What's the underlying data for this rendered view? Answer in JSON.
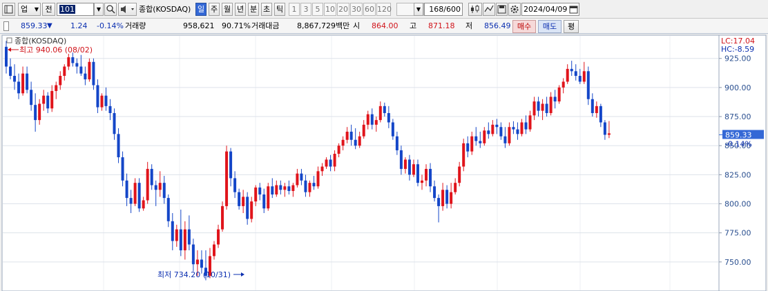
{
  "toolbar": {
    "market_label": "업",
    "prev_label": "전",
    "code_value": "101",
    "index_name": "종합(KOSDAQ)",
    "periods": [
      {
        "label": "일",
        "active": true
      },
      {
        "label": "주",
        "active": false
      },
      {
        "label": "월",
        "active": false
      },
      {
        "label": "년",
        "active": false
      },
      {
        "label": "분",
        "active": false
      },
      {
        "label": "초",
        "active": false
      },
      {
        "label": "틱",
        "active": false
      }
    ],
    "intervals": [
      "1",
      "3",
      "5",
      "10",
      "20",
      "30",
      "60",
      "120"
    ],
    "count_value": "168",
    "count_max": "/600",
    "date_value": "2024/04/09"
  },
  "quote": {
    "price": "859.33",
    "change_arrow": "▼",
    "change": "1.24",
    "change_pct": "-0.14%",
    "volume_label": "거래량",
    "volume": "958,621",
    "volume_ratio": "90.71%",
    "amount_label": "거래대금",
    "amount": "8,867,729백만",
    "open_label": "시",
    "open": "864.00",
    "high_label": "고",
    "high": "871.18",
    "low_label": "저",
    "low": "856.49",
    "buy_label": "매수",
    "sell_label": "매도",
    "eval_label": "평"
  },
  "colors": {
    "up": "#e0141b",
    "down": "#1446c8",
    "accent": "#3468d6"
  },
  "chart_data": {
    "type": "candlestick",
    "title": "종합(KOSDAQ)",
    "ylim": [
      725,
      945
    ],
    "yticks": [
      "925.00",
      "900.00",
      "875.00",
      "850.00",
      "825.00",
      "800.00",
      "775.00",
      "750.00"
    ],
    "ytick_values": [
      925,
      900,
      875,
      850,
      825,
      800,
      775,
      750
    ],
    "lc_label": "LC:17.04",
    "hc_label": "HC:-8.59",
    "last_price_label": "859.33",
    "last_change_label": "-0.14%",
    "last_price": 859.33,
    "high_annotation": "최고 940.06 (08/02)",
    "low_annotation": "최저 734.20 (10/31)",
    "candles": [
      [
        935.0,
        940.06,
        912.0,
        918.0
      ],
      [
        918.0,
        925.0,
        907.0,
        910.0
      ],
      [
        910.0,
        920.0,
        898.0,
        905.0
      ],
      [
        905.0,
        912.0,
        890.0,
        895.0
      ],
      [
        895.0,
        918.0,
        893.0,
        912.0
      ],
      [
        912.0,
        918.0,
        895.0,
        898.0
      ],
      [
        898.0,
        905.0,
        880.0,
        885.0
      ],
      [
        885.0,
        895.0,
        862.0,
        872.0
      ],
      [
        872.0,
        890.0,
        868.0,
        886.0
      ],
      [
        886.0,
        898.0,
        880.0,
        893.0
      ],
      [
        893.0,
        896.0,
        878.0,
        882.0
      ],
      [
        882.0,
        902.0,
        879.0,
        897.0
      ],
      [
        897.0,
        905.0,
        890.0,
        902.0
      ],
      [
        902.0,
        914.0,
        898.0,
        910.0
      ],
      [
        910.0,
        920.0,
        906.0,
        918.0
      ],
      [
        918.0,
        929.0,
        915.0,
        926.0
      ],
      [
        926.0,
        930.0,
        918.0,
        921.0
      ],
      [
        921.0,
        925.0,
        912.0,
        918.0
      ],
      [
        918.0,
        928.0,
        910.0,
        912.0
      ],
      [
        912.0,
        918.0,
        902.0,
        907.0
      ],
      [
        907.0,
        925.0,
        905.0,
        922.0
      ],
      [
        922.0,
        925.0,
        898.0,
        902.0
      ],
      [
        902.0,
        907.0,
        878.0,
        883.0
      ],
      [
        883.0,
        895.0,
        880.0,
        893.0
      ],
      [
        893.0,
        900.0,
        880.0,
        884.0
      ],
      [
        884.0,
        890.0,
        872.0,
        878.0
      ],
      [
        878.0,
        882.0,
        855.0,
        860.0
      ],
      [
        860.0,
        865.0,
        835.0,
        840.0
      ],
      [
        840.0,
        845.0,
        815.0,
        820.0
      ],
      [
        820.0,
        826.0,
        798.0,
        805.0
      ],
      [
        805.0,
        812.0,
        792.0,
        800.0
      ],
      [
        800.0,
        822.0,
        798.0,
        818.0
      ],
      [
        818.0,
        822.0,
        793.0,
        796.0
      ],
      [
        796.0,
        806.0,
        794.0,
        803.0
      ],
      [
        803.0,
        836.0,
        800.0,
        830.0
      ],
      [
        830.0,
        834.0,
        812.0,
        816.0
      ],
      [
        816.0,
        820.0,
        798.0,
        812.0
      ],
      [
        812.0,
        828.0,
        806.0,
        818.0
      ],
      [
        818.0,
        824.0,
        800.0,
        805.0
      ],
      [
        805.0,
        808.0,
        780.0,
        785.0
      ],
      [
        785.0,
        792.0,
        760.0,
        768.0
      ],
      [
        768.0,
        782.0,
        763.0,
        778.0
      ],
      [
        778.0,
        795.0,
        755.0,
        760.0
      ],
      [
        760.0,
        785.0,
        752.0,
        778.0
      ],
      [
        778.0,
        790.0,
        760.0,
        765.0
      ],
      [
        765.0,
        770.0,
        742.0,
        748.0
      ],
      [
        748.0,
        760.0,
        738.0,
        752.0
      ],
      [
        752.0,
        760.0,
        740.0,
        745.0
      ],
      [
        745.0,
        760.0,
        734.2,
        738.0
      ],
      [
        738.0,
        762.0,
        736.0,
        755.0
      ],
      [
        755.0,
        768.0,
        752.0,
        765.0
      ],
      [
        765.0,
        782.0,
        762.0,
        778.0
      ],
      [
        778.0,
        802.0,
        776.0,
        798.0
      ],
      [
        798.0,
        850.0,
        795.0,
        845.0
      ],
      [
        845.0,
        848.0,
        815.0,
        822.0
      ],
      [
        822.0,
        828.0,
        805.0,
        810.0
      ],
      [
        810.0,
        813.0,
        795.0,
        798.0
      ],
      [
        798.0,
        812.0,
        792.0,
        806.0
      ],
      [
        806.0,
        810.0,
        782.0,
        787.0
      ],
      [
        787.0,
        806.0,
        784.0,
        802.0
      ],
      [
        802.0,
        816.0,
        798.0,
        814.0
      ],
      [
        814.0,
        818.0,
        803.0,
        808.0
      ],
      [
        808.0,
        813.0,
        792.0,
        796.0
      ],
      [
        796.0,
        818.0,
        794.0,
        815.0
      ],
      [
        815.0,
        822.0,
        805.0,
        808.0
      ],
      [
        808.0,
        820.0,
        806.0,
        816.0
      ],
      [
        816.0,
        820.0,
        808.0,
        812.0
      ],
      [
        812.0,
        818.0,
        806.0,
        815.0
      ],
      [
        815.0,
        820.0,
        808.0,
        811.0
      ],
      [
        811.0,
        818.0,
        806.0,
        816.0
      ],
      [
        816.0,
        830.0,
        814.0,
        826.0
      ],
      [
        826.0,
        830.0,
        816.0,
        820.0
      ],
      [
        820.0,
        825.0,
        806.0,
        810.0
      ],
      [
        810.0,
        820.0,
        806.0,
        818.0
      ],
      [
        818.0,
        824.0,
        812.0,
        815.0
      ],
      [
        815.0,
        832.0,
        813.0,
        828.0
      ],
      [
        828.0,
        835.0,
        824.0,
        832.0
      ],
      [
        832.0,
        840.0,
        830.0,
        838.0
      ],
      [
        838.0,
        842.0,
        828.0,
        832.0
      ],
      [
        832.0,
        846.0,
        828.0,
        843.0
      ],
      [
        843.0,
        852.0,
        840.0,
        850.0
      ],
      [
        850.0,
        858.0,
        846.0,
        855.0
      ],
      [
        855.0,
        866.0,
        852.0,
        862.0
      ],
      [
        862.0,
        868.0,
        850.0,
        855.0
      ],
      [
        855.0,
        865.0,
        847.0,
        850.0
      ],
      [
        850.0,
        862.0,
        848.0,
        858.0
      ],
      [
        858.0,
        872.0,
        856.0,
        868.0
      ],
      [
        868.0,
        880.0,
        864.0,
        877.0
      ],
      [
        877.0,
        882.0,
        864.0,
        868.0
      ],
      [
        868.0,
        875.0,
        862.0,
        872.0
      ],
      [
        872.0,
        888.0,
        870.0,
        884.0
      ],
      [
        884.0,
        887.0,
        875.0,
        878.0
      ],
      [
        878.0,
        884.0,
        865.0,
        870.0
      ],
      [
        870.0,
        873.0,
        855.0,
        858.0
      ],
      [
        858.0,
        862.0,
        842.0,
        846.0
      ],
      [
        846.0,
        850.0,
        825.0,
        830.0
      ],
      [
        830.0,
        840.0,
        826.0,
        838.0
      ],
      [
        838.0,
        842.0,
        820.0,
        825.0
      ],
      [
        825.0,
        838.0,
        823.0,
        834.0
      ],
      [
        834.0,
        838.0,
        815.0,
        818.0
      ],
      [
        818.0,
        825.0,
        812.0,
        820.0
      ],
      [
        820.0,
        834.0,
        815.0,
        830.0
      ],
      [
        830.0,
        835.0,
        810.0,
        815.0
      ],
      [
        815.0,
        820.0,
        802.0,
        805.0
      ],
      [
        805.0,
        808.0,
        784.0,
        798.0
      ],
      [
        798.0,
        818.0,
        794.0,
        812.0
      ],
      [
        812.0,
        816.0,
        796.0,
        800.0
      ],
      [
        800.0,
        818.0,
        796.0,
        810.0
      ],
      [
        810.0,
        822.0,
        808.0,
        818.0
      ],
      [
        818.0,
        836.0,
        815.0,
        832.0
      ],
      [
        832.0,
        856.0,
        828.0,
        852.0
      ],
      [
        852.0,
        858.0,
        840.0,
        845.0
      ],
      [
        845.0,
        862.0,
        842.0,
        858.0
      ],
      [
        858.0,
        866.0,
        850.0,
        854.0
      ],
      [
        854.0,
        862.0,
        848.0,
        852.0
      ],
      [
        852.0,
        866.0,
        850.0,
        863.0
      ],
      [
        863.0,
        870.0,
        856.0,
        860.0
      ],
      [
        860.0,
        872.0,
        858.0,
        868.0
      ],
      [
        868.0,
        873.0,
        860.0,
        866.0
      ],
      [
        866.0,
        870.0,
        855.0,
        858.0
      ],
      [
        858.0,
        866.0,
        848.0,
        852.0
      ],
      [
        852.0,
        870.0,
        850.0,
        866.0
      ],
      [
        866.0,
        871.0,
        860.0,
        864.0
      ],
      [
        864.0,
        870.0,
        855.0,
        860.0
      ],
      [
        860.0,
        873.0,
        858.0,
        870.0
      ],
      [
        870.0,
        876.0,
        860.0,
        864.0
      ],
      [
        864.0,
        880.0,
        862.0,
        876.0
      ],
      [
        876.0,
        892.0,
        872.0,
        888.0
      ],
      [
        888.0,
        892.0,
        875.0,
        880.0
      ],
      [
        880.0,
        890.0,
        872.0,
        886.0
      ],
      [
        886.0,
        892.0,
        875.0,
        878.0
      ],
      [
        878.0,
        896.0,
        876.0,
        892.0
      ],
      [
        892.0,
        898.0,
        882.0,
        888.0
      ],
      [
        888.0,
        902.0,
        886.0,
        900.0
      ],
      [
        900.0,
        908.0,
        895.0,
        905.0
      ],
      [
        905.0,
        920.0,
        903.0,
        916.0
      ],
      [
        916.0,
        923.0,
        910.0,
        914.0
      ],
      [
        914.0,
        920.0,
        906.0,
        910.0
      ],
      [
        910.0,
        916.0,
        903.0,
        905.0
      ],
      [
        905.0,
        922.0,
        903.0,
        914.0
      ],
      [
        914.0,
        918.0,
        885.0,
        890.0
      ],
      [
        890.0,
        895.0,
        875.0,
        878.0
      ],
      [
        878.0,
        888.0,
        874.0,
        884.0
      ],
      [
        884.0,
        886.0,
        866.0,
        870.0
      ],
      [
        870.0,
        872.0,
        855.0,
        859.33
      ],
      [
        859.33,
        871.18,
        856.49,
        860.57
      ]
    ]
  }
}
